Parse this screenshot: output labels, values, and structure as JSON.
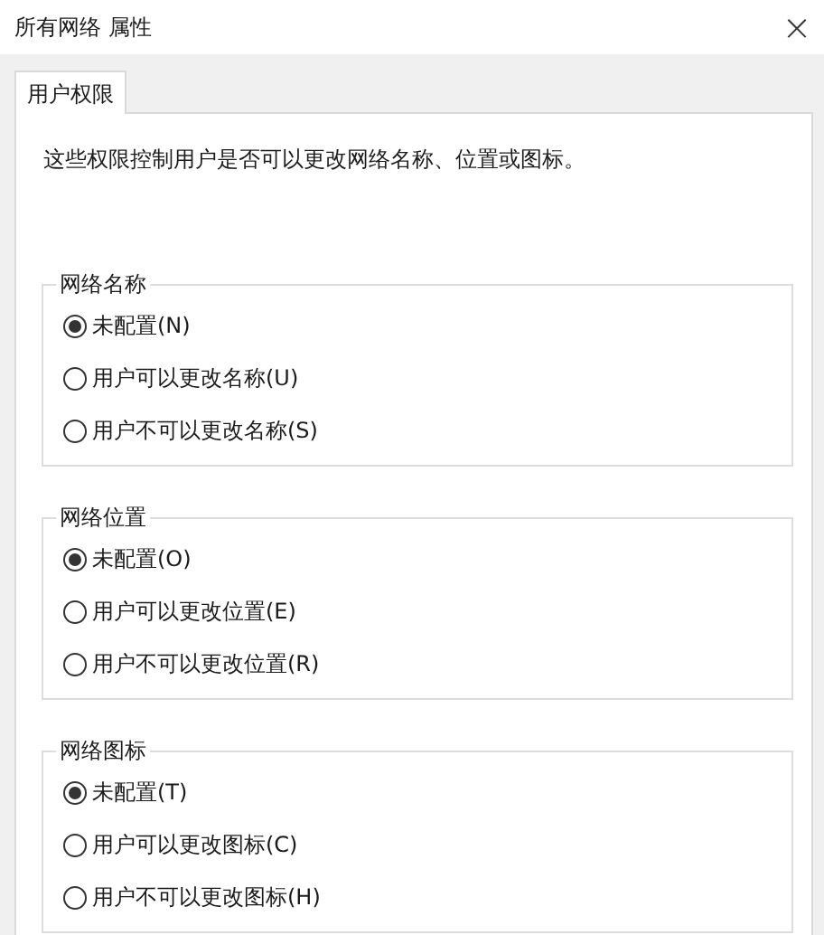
{
  "window": {
    "title": "所有网络 属性",
    "close": "×"
  },
  "tabs": [
    {
      "label": "用户权限",
      "selected": true
    }
  ],
  "description": "这些权限控制用户是否可以更改网络名称、位置或图标。",
  "groups": [
    {
      "title": "网络名称",
      "options": [
        {
          "label": "未配置(N)",
          "selected": true
        },
        {
          "label": "用户可以更改名称(U)",
          "selected": false
        },
        {
          "label": "用户不可以更改名称(S)",
          "selected": false
        }
      ]
    },
    {
      "title": "网络位置",
      "options": [
        {
          "label": "未配置(O)",
          "selected": true
        },
        {
          "label": "用户可以更改位置(E)",
          "selected": false
        },
        {
          "label": "用户不可以更改位置(R)",
          "selected": false
        }
      ]
    },
    {
      "title": "网络图标",
      "options": [
        {
          "label": "未配置(T)",
          "selected": true
        },
        {
          "label": "用户可以更改图标(C)",
          "selected": false
        },
        {
          "label": "用户不可以更改图标(H)",
          "selected": false
        }
      ]
    }
  ]
}
